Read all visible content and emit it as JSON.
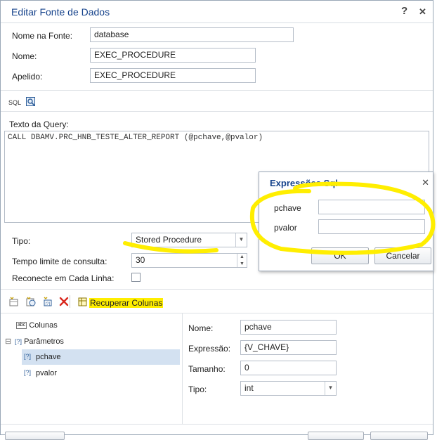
{
  "dialog": {
    "title": "Editar Fonte de Dados",
    "help_glyph": "?",
    "close_glyph": "✕"
  },
  "form": {
    "source_name_label": "Nome na Fonte:",
    "source_name_value": "database",
    "name_label": "Nome:",
    "name_value": "EXEC_PROCEDURE",
    "alias_label": "Apelido:",
    "alias_value": "EXEC_PROCEDURE"
  },
  "sql_toolbar": {
    "sql_label": "SQL"
  },
  "query": {
    "label": "Texto da Query:",
    "text": "CALL DBAMV.PRC_HNB_TESTE_ALTER_REPORT (@pchave,@pvalor)"
  },
  "options": {
    "type_label": "Tipo:",
    "type_value": "Stored Procedure",
    "timeout_label": "Tempo limite de consulta:",
    "timeout_value": "30",
    "reconnect_label": "Reconecte em Cada Linha:"
  },
  "columns_toolbar": {
    "retrieve_label": "Recuperar Colunas"
  },
  "tree": {
    "columns_label": "Colunas",
    "params_label": "Parâmetros",
    "expand_glyph": "⊟",
    "params": [
      "pchave",
      "pvalor"
    ],
    "column_icon_text": "abc",
    "param_icon_text": "[?]"
  },
  "props": {
    "name_label": "Nome:",
    "name_value": "pchave",
    "expr_label": "Expressão:",
    "expr_value": "{V_CHAVE}",
    "size_label": "Tamanho:",
    "size_value": "0",
    "type_label": "Tipo:",
    "type_value": "int"
  },
  "sql_expressions": {
    "title": "Expressões Sql",
    "close_glyph": "✕",
    "pchave_label": "pchave",
    "pchave_value": "",
    "pvalor_label": "pvalor",
    "pvalor_value": "",
    "ok_label": "OK",
    "cancel_label": "Cancelar"
  },
  "colors": {
    "title_blue": "#15428b",
    "highlight_yellow": "#ffee00",
    "selection_blue": "#d3e1f1"
  }
}
